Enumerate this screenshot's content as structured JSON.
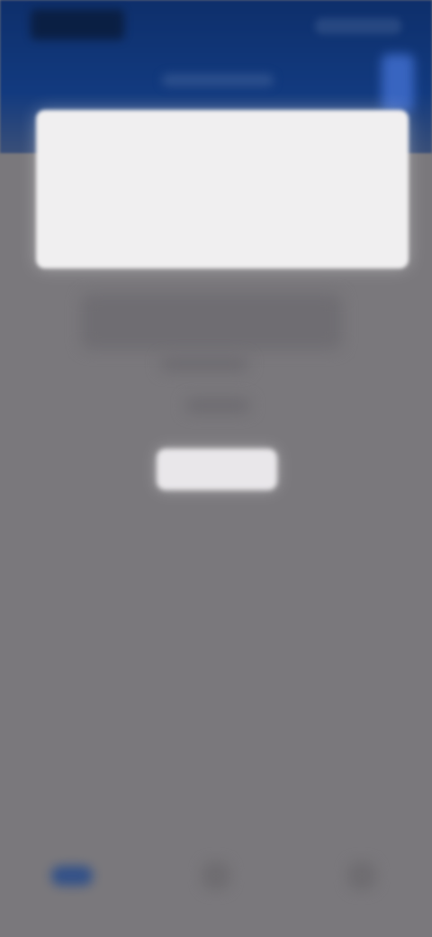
{
  "header": {
    "status_bar": {
      "left_icon": "app-logo-icon",
      "right_icons": "status-icons"
    },
    "title_placeholder": "page-title",
    "right_action_icon": "menu-icon"
  },
  "hero": {
    "icon": "banner-image-icon"
  },
  "content": {
    "placeholder_title": "content-title",
    "placeholder_line1": "content-line-1",
    "placeholder_line2": "content-line-2",
    "action_button": "primary-button"
  },
  "bottom_nav": {
    "items": [
      {
        "icon": "home-icon"
      },
      {
        "icon": "center-icon"
      },
      {
        "icon": "profile-icon"
      }
    ]
  },
  "colors": {
    "overlay": "#7a787c",
    "header": "#123a7f",
    "card": "#f0eff0",
    "button": "#e9e7ea",
    "accent": "#3d6ac8"
  }
}
